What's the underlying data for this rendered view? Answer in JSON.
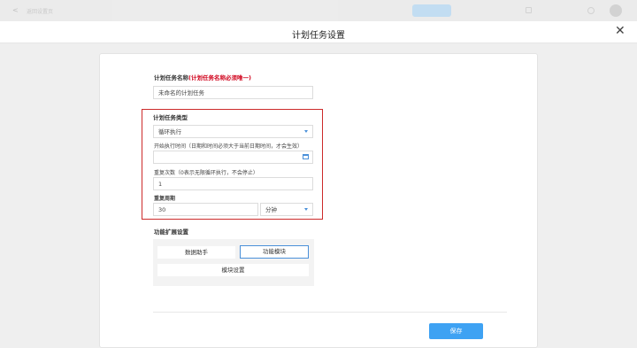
{
  "background_bar": {
    "back_glyph": "<",
    "page_title": "返回设置页",
    "action_pill": "",
    "action_text": "",
    "extra_text": ""
  },
  "dialog": {
    "title": "计划任务设置",
    "close_glyph": "✕"
  },
  "form": {
    "name_label": "计划任务名称",
    "name_required_note": "(计划任务名称必须唯一)",
    "name_value": "未命名的计划任务",
    "type_label": "计划任务类型",
    "type_value": "循环执行",
    "start_time_label": "开始执行时间（日期和时间必须大于当前日期时间，才会生效）",
    "start_time_value": "",
    "repeat_count_label": "重复次数（0表示无限循环执行，不会停止）",
    "repeat_count_value": "1",
    "repeat_period_label": "重复周期",
    "repeat_period_value": "30",
    "repeat_period_unit": "分钟",
    "extension_label": "功能扩展设置",
    "ext_buttons": {
      "data_helper": "数据助手",
      "function_module": "功能模块",
      "module_settings": "模块设置"
    },
    "save_label": "保存"
  },
  "colors": {
    "accent": "#3ea2f3",
    "highlight_border": "#cc2a2a",
    "required": "#d0021b"
  }
}
